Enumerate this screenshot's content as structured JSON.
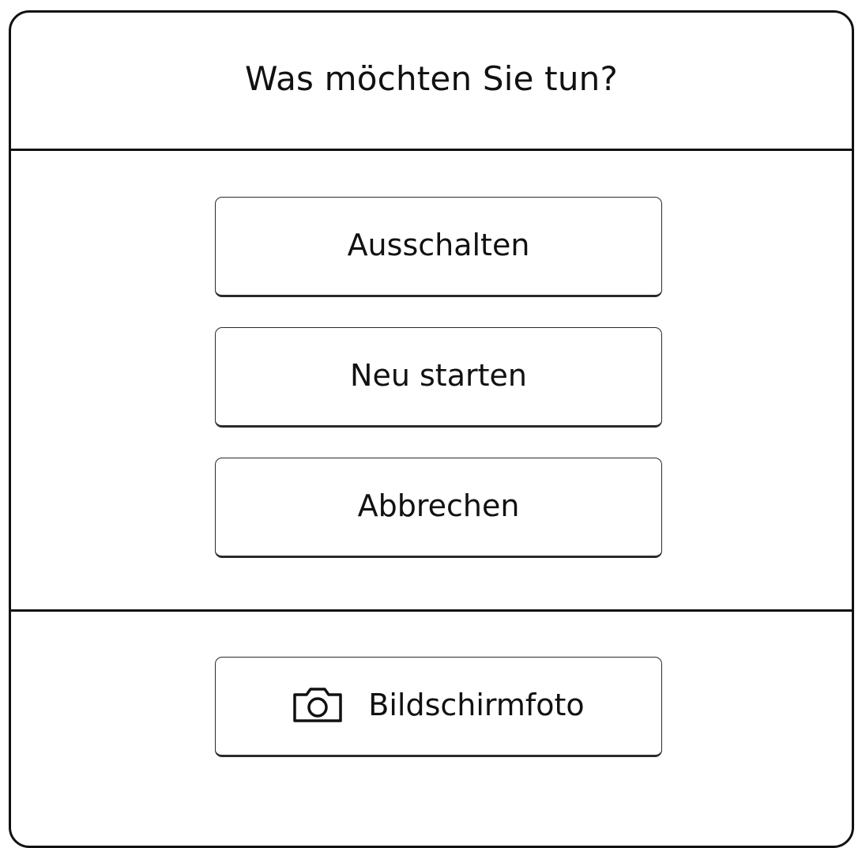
{
  "dialog": {
    "title": "Was möchten Sie tun?",
    "actions": [
      {
        "label": "Ausschalten"
      },
      {
        "label": "Neu starten"
      },
      {
        "label": "Abbrechen"
      }
    ],
    "screenshot": {
      "label": "Bildschirmfoto",
      "icon": "camera-icon"
    }
  }
}
